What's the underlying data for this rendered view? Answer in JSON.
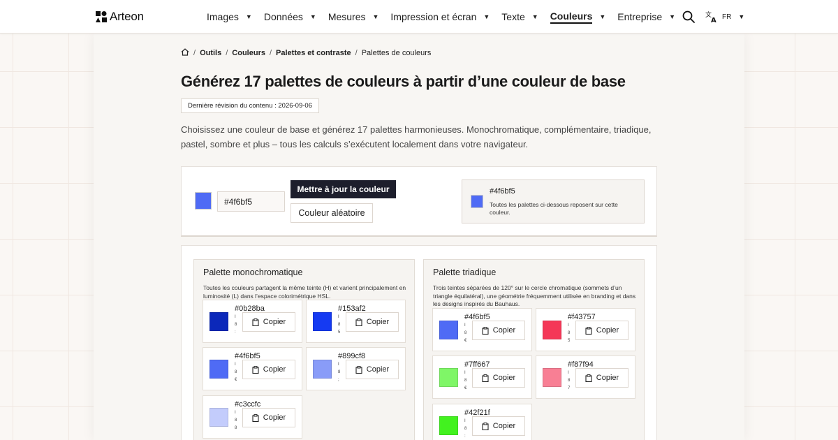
{
  "header": {
    "logo_text": "Arteon",
    "nav": [
      {
        "label": "Images",
        "active": false
      },
      {
        "label": "Données",
        "active": false
      },
      {
        "label": "Mesures",
        "active": false
      },
      {
        "label": "Impression et écran",
        "active": false
      },
      {
        "label": "Texte",
        "active": false
      },
      {
        "label": "Couleurs",
        "active": true
      },
      {
        "label": "Entreprise",
        "active": false
      }
    ],
    "lang_code": "FR"
  },
  "breadcrumb": {
    "items": [
      "Outils",
      "Couleurs",
      "Palettes et contraste"
    ],
    "current": "Palettes de couleurs"
  },
  "page": {
    "title": "Générez 17 palettes de couleurs à partir d’une couleur de base",
    "revision": "Dernière révision du contenu : 2026-09-06",
    "intro": "Choisissez une couleur de base et générez 17 palettes harmonieuses. Monochromatique, complémentaire, triadique, pastel, sombre et plus – tous les calculs s’exécutent localement dans votre navigateur."
  },
  "controls": {
    "base_color": "#4f6bf5",
    "hex_value": "#4f6bf5",
    "update_label": "Mettre à jour la couleur",
    "random_label": "Couleur aléatoire",
    "base_hex": "#4f6bf5",
    "base_note": "Toutes les palettes ci-dessous reposent sur cette couleur."
  },
  "copy_label": "Copier",
  "palettes": [
    {
      "title": "Palette monochromatique",
      "desc": "Toutes les couleurs partagent la même teinte (H) et varient principalement en luminosité (L) dans l’espace colorimétrique HSL.",
      "colors": [
        {
          "hex": "#0b28ba",
          "tiny": "I 8 :"
        },
        {
          "hex": "#153af2",
          "tiny": "I 8 5"
        },
        {
          "hex": "#4f6bf5",
          "tiny": "I 8 €"
        },
        {
          "hex": "#899cf8",
          "tiny": "I 8 ;"
        },
        {
          "hex": "#c3ccfc",
          "tiny": "I 8 8"
        }
      ]
    },
    {
      "title": "Palette triadique",
      "desc": "Trois teintes séparées de 120° sur le cercle chromatique (sommets d’un triangle équilatéral), une géométrie fréquemment utilisée en branding et dans les designs inspirés du Bauhaus.",
      "colors": [
        {
          "hex": "#4f6bf5",
          "tiny": "I 8 €"
        },
        {
          "hex": "#f43757",
          "tiny": "I 8 5"
        },
        {
          "hex": "#7ff667",
          "tiny": "I 8 €"
        },
        {
          "hex": "#f87f94",
          "tiny": "I 8 7"
        },
        {
          "hex": "#42f21f",
          "tiny": "I 8 :"
        }
      ]
    }
  ]
}
